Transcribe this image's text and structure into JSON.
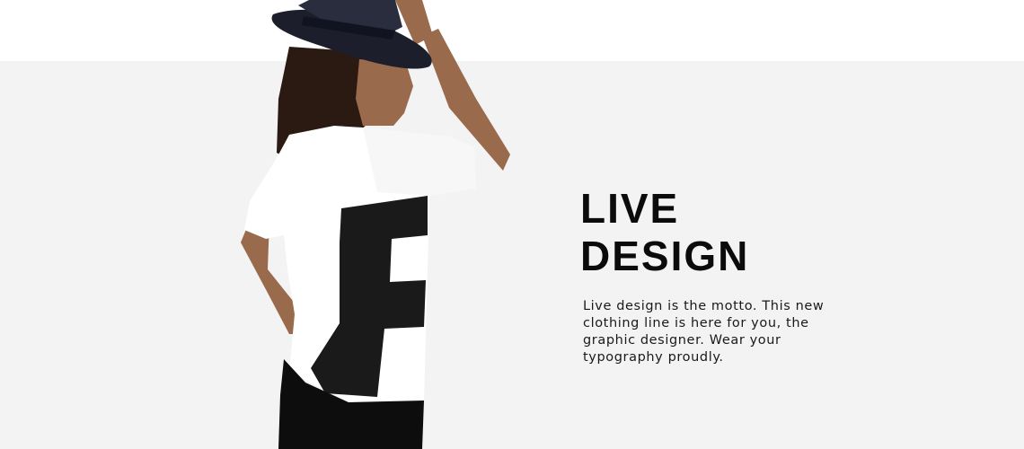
{
  "hero": {
    "headline_line1": "LIVE",
    "headline_line2": "DESIGN",
    "body": "Live design is the motto. This new clothing line is here for you, the graphic designer. Wear your typography proudly."
  },
  "colors": {
    "page_background": "#ffffff",
    "band_background": "#f3f3f3",
    "headline": "#0b0b0b",
    "body_text": "#1a1a1a",
    "hat": "#1c1e2b",
    "shirt": "#ffffff",
    "shirt_graphic": "#1a1a1a",
    "skin": "#9a6a4c",
    "hair": "#2a1a12",
    "trousers": "#0d0d0d"
  }
}
